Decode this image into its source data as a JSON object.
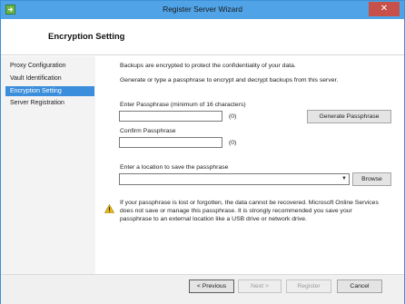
{
  "window": {
    "title": "Register Server Wizard",
    "close_glyph": "✕",
    "icon": "wizard-app-icon"
  },
  "header": {
    "title": "Encryption Setting"
  },
  "sidebar": {
    "items": [
      {
        "label": "Proxy Configuration",
        "active": false
      },
      {
        "label": "Vault Identification",
        "active": false
      },
      {
        "label": "Encryption Setting",
        "active": true
      },
      {
        "label": "Server Registration",
        "active": false
      }
    ]
  },
  "main": {
    "intro1": "Backups are encrypted to protect the confidentiality of your data.",
    "intro2": "Generate or type a passphrase to encrypt and decrypt backups from this server.",
    "passphrase_label": "Enter Passphrase (minimum of 16 characters)",
    "passphrase_value": "",
    "passphrase_count": "(0)",
    "generate_button": "Generate Passphrase",
    "confirm_label": "Confirm Passphrase",
    "confirm_value": "",
    "confirm_count": "(0)",
    "location_label": "Enter a location to save the passphrase",
    "location_value": "",
    "browse_button": "Browse",
    "warning_lines": [
      "If your passphrase is lost or forgotten, the data cannot be recovered. Microsoft Online Services",
      "does not save or manage this passphrase. It is strongly recommended you save your",
      "passphrase to an external location like a USB drive or network drive."
    ],
    "warning_icon": "warning-icon",
    "accent_color": "#3a8edb",
    "warning_color": "#e8b90f"
  },
  "footer": {
    "previous": "< Previous",
    "next": "Next >",
    "register": "Register",
    "cancel": "Cancel"
  }
}
